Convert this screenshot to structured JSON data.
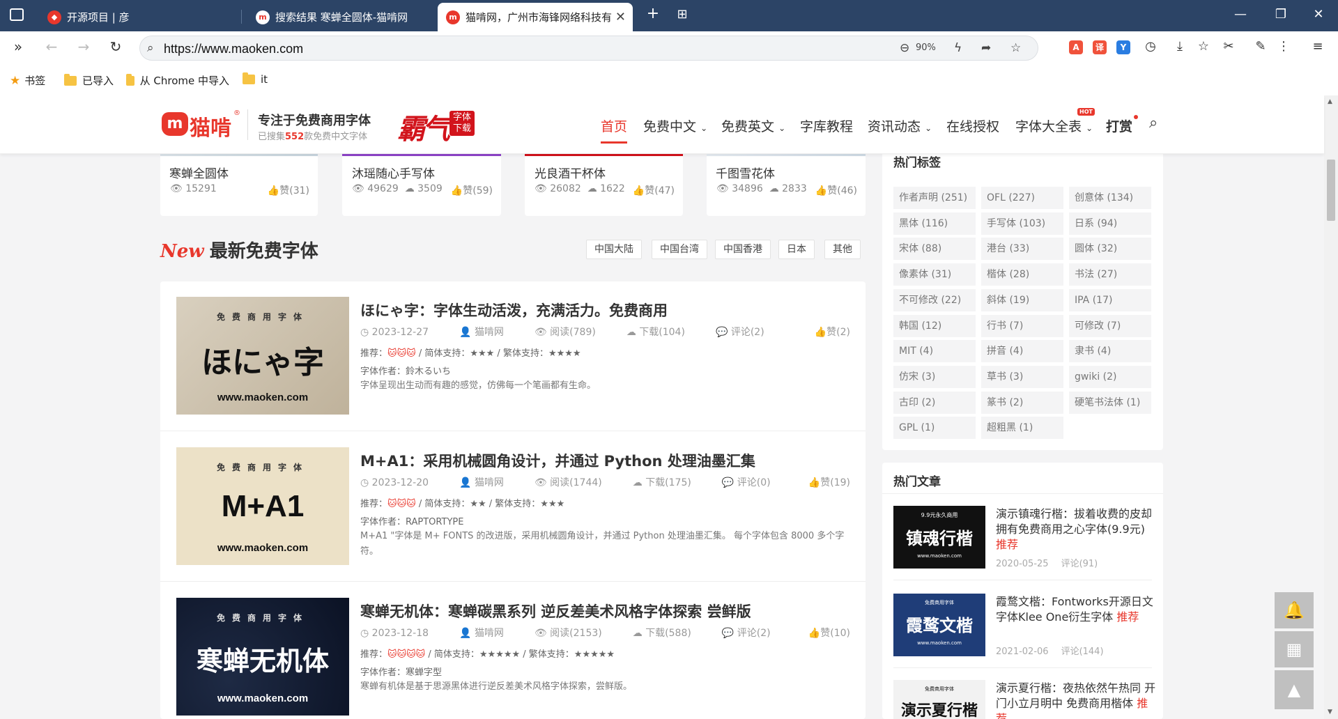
{
  "browser": {
    "tabs": [
      {
        "title": "开源项目 | 彦",
        "active": false
      },
      {
        "title": "搜索结果 寒蝉全圆体-猫啃网",
        "active": false
      },
      {
        "title": "猫啃网，广州市海锋网络科技有限公司",
        "active": true
      }
    ],
    "url": "https://www.maoken.com",
    "zoom": "90%",
    "bookmarks": [
      "书签",
      "已导入",
      "从 Chrome 中导入",
      "it"
    ]
  },
  "site": {
    "logo_text": "猫啃",
    "logo_mark": "m",
    "logo_reg": "®",
    "slogan": "专注于免费商用字体",
    "subslogan_prefix": "已搜集",
    "subslogan_count": "552",
    "subslogan_suffix": "款免费中文字体",
    "banner_text": "霸气",
    "banner_badge": "字体下载",
    "nav": [
      "首页",
      "免费中文",
      "免费英文",
      "字库教程",
      "资讯动态",
      "在线授权",
      "字体大全表",
      "打赏"
    ],
    "hot_badge": "HOT"
  },
  "top_cards": [
    {
      "title": "寒蝉全圆体",
      "views": "15291",
      "downloads": "",
      "likes": "赞(31)"
    },
    {
      "title": "沐瑶随心手写体",
      "views": "49629",
      "downloads": "3509",
      "likes": "赞(59)"
    },
    {
      "title": "光良酒干杯体",
      "views": "26082",
      "downloads": "1622",
      "likes": "赞(47)"
    },
    {
      "title": "千图雪花体",
      "views": "34896",
      "downloads": "2833",
      "likes": "赞(46)"
    }
  ],
  "latest": {
    "badge": "New",
    "title": "最新免费字体",
    "regions": [
      "中国大陆",
      "中国台湾",
      "中国香港",
      "日本",
      "其他"
    ]
  },
  "items": [
    {
      "thumb_top": "免费商用字体",
      "thumb_main": "ほにゃ字",
      "thumb_site": "www.maoken.com",
      "title": "ほにゃ字：字体生动活泼，充满活力。免费商用",
      "date": "2023-12-27",
      "author_site": "猫啃网",
      "reads": "阅读(789)",
      "downloads": "下载(104)",
      "comments": "评论(2)",
      "likes": "赞(2)",
      "rec_label": "推荐：",
      "rec_cats": "🐱🐱🐱",
      "support": " / 简体支持：★★★ / 繁体支持：★★★★",
      "font_author": "字体作者：鈴木るいち",
      "desc": "字体呈现出生动而有趣的感觉，仿佛每一个笔画都有生命。"
    },
    {
      "thumb_top": "免费商用字体",
      "thumb_main": "M+A1",
      "thumb_site": "www.maoken.com",
      "title": "M+A1：采用机械圆角设计，并通过 Python 处理油墨汇集",
      "date": "2023-12-20",
      "author_site": "猫啃网",
      "reads": "阅读(1744)",
      "downloads": "下载(175)",
      "comments": "评论(0)",
      "likes": "赞(19)",
      "rec_label": "推荐：",
      "rec_cats": "🐱🐱🐱",
      "support": " / 简体支持：★★ / 繁体支持：★★★",
      "font_author": "字体作者：RAPTORTYPE",
      "desc": "M+A1 \"字体是 M+ FONTS 的改进版，采用机械圆角设计，并通过 Python 处理油墨汇集。 每个字体包含 8000 多个字符。"
    },
    {
      "thumb_top": "免费商用字体",
      "thumb_main": "寒蝉无机体",
      "thumb_site": "www.maoken.com",
      "title": "寒蝉无机体：寒蝉碳黑系列 逆反差美术风格字体探索 尝鲜版",
      "date": "2023-12-18",
      "author_site": "猫啃网",
      "reads": "阅读(2153)",
      "downloads": "下载(588)",
      "comments": "评论(2)",
      "likes": "赞(10)",
      "rec_label": "推荐：",
      "rec_cats": "🐱🐱🐱🐱",
      "support": " / 简体支持：★★★★★ / 繁体支持：★★★★★",
      "font_author": "字体作者：寒蝉字型",
      "desc": "寒蝉有机体是基于思源黑体进行逆反差美术风格字体探索，尝鲜版。"
    }
  ],
  "sidebar": {
    "tags_title": "热门标签",
    "tags": [
      "作者声明 (251)",
      "OFL (227)",
      "创意体 (134)",
      "黑体 (116)",
      "手写体 (103)",
      "日系 (94)",
      "宋体 (88)",
      "港台 (33)",
      "圆体 (32)",
      "像素体 (31)",
      "楷体 (28)",
      "书法 (27)",
      "不可修改 (22)",
      "斜体 (19)",
      "IPA (17)",
      "韩国 (12)",
      "行书 (7)",
      "可修改 (7)",
      "MIT (4)",
      "拼音 (4)",
      "隶书 (4)",
      "仿宋 (3)",
      "草书 (3)",
      "gwiki (2)",
      "古印 (2)",
      "篆书 (2)",
      "硬笔书法体 (1)",
      "GPL (1)",
      "超粗黑 (1)"
    ],
    "articles_title": "热门文章",
    "articles": [
      {
        "thumb_small": "9.9元永久商用",
        "thumb_main": "镇魂行楷",
        "thumb_site": "www.maoken.com",
        "title": "演示镇魂行楷：拔着收费的皮却拥有免费商用之心字体(9.9元)",
        "rec": "推荐",
        "date": "2020-05-25",
        "comments": "评论(91)"
      },
      {
        "thumb_small": "免费商用字体",
        "thumb_main": "霞鹜文楷",
        "thumb_site": "www.maoken.com",
        "title": "霞鹜文楷：Fontworks开源日文字体Klee One衍生字体",
        "rec": "推荐",
        "date": "2021-02-06",
        "comments": "评论(144)"
      },
      {
        "thumb_small": "免费商用字体",
        "thumb_main": "演示夏行楷",
        "thumb_site": "",
        "title": "演示夏行楷：夜热依然午热同 开门小立月明中 免费商用楷体",
        "rec": "推荐",
        "date": "",
        "comments": ""
      }
    ]
  },
  "colors": {
    "brand": "#e8372c",
    "tabbar": "#2c4466"
  }
}
